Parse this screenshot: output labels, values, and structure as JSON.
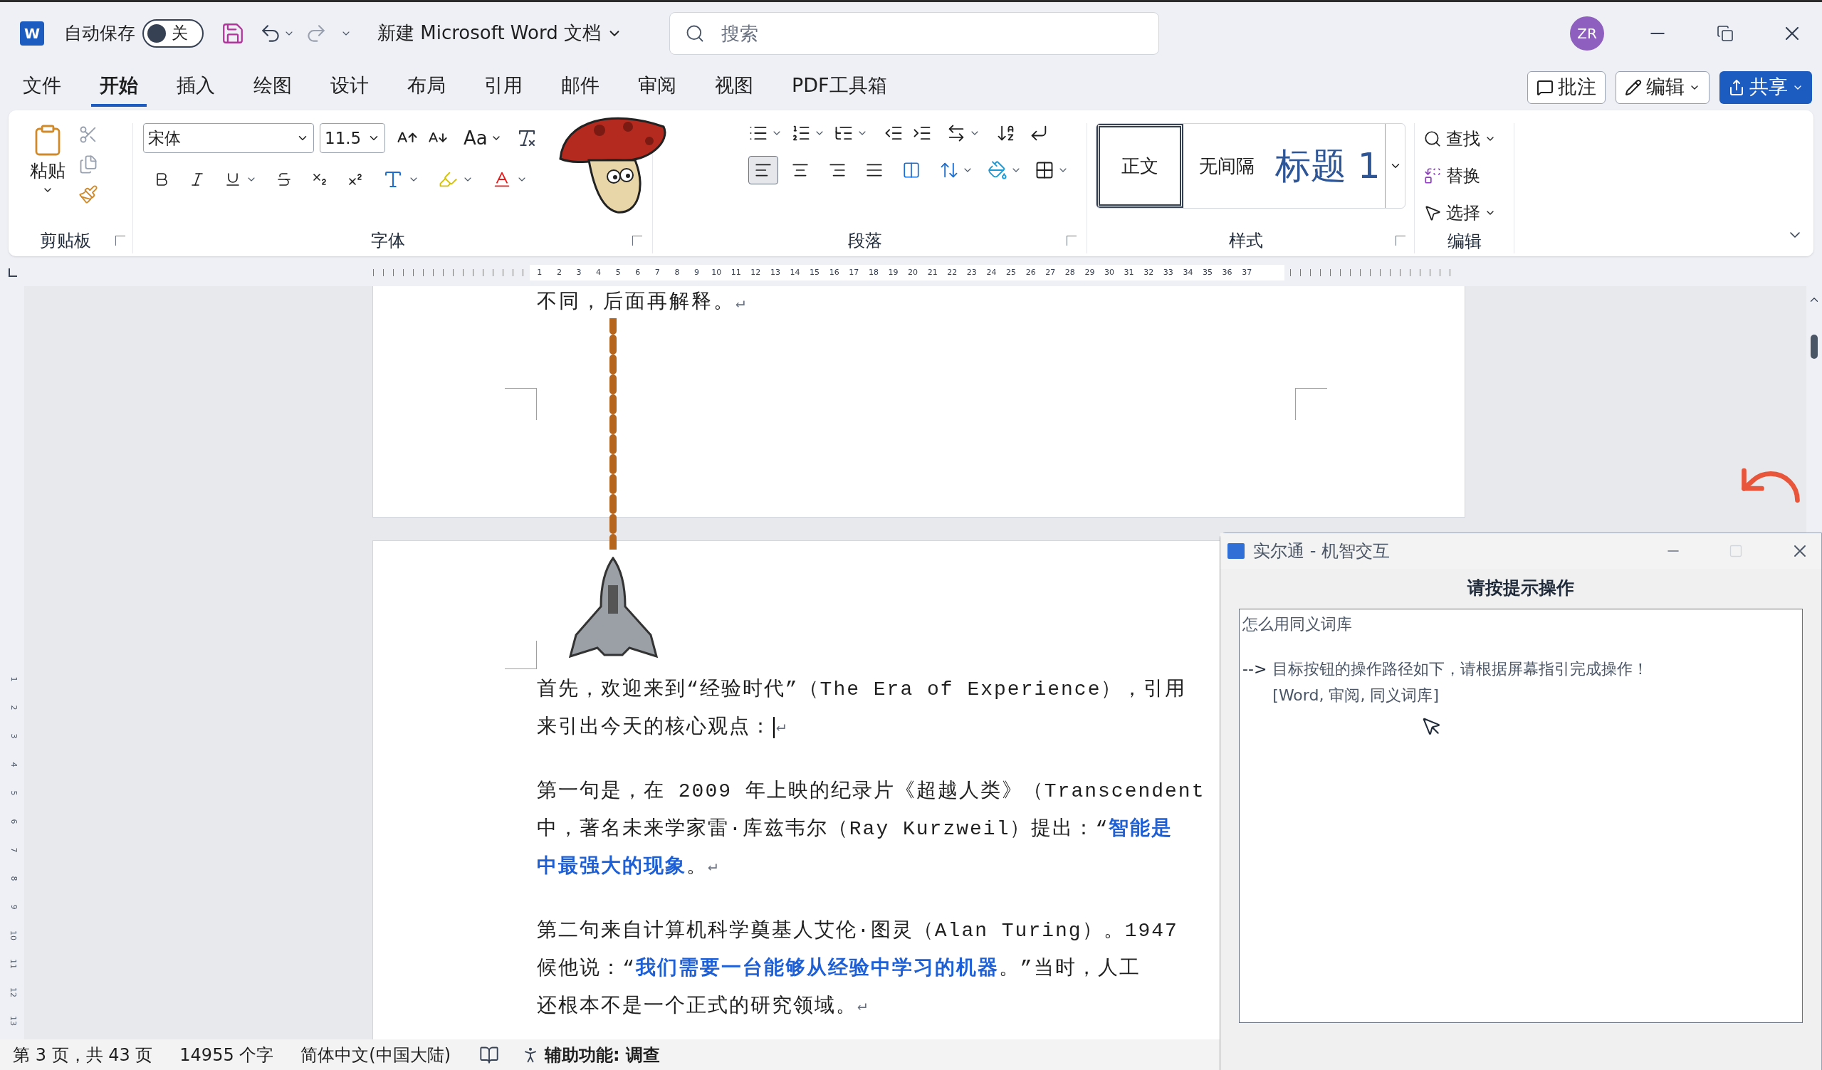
{
  "title_bar": {
    "app_badge": "W",
    "autosave": {
      "label": "自动保存",
      "on": false,
      "state_text": "关"
    },
    "document_title": "新建 Microsoft Word 文档",
    "search": {
      "placeholder": "搜索"
    },
    "avatar": "ZR"
  },
  "menu_tabs": [
    {
      "label": "文件",
      "selected": false
    },
    {
      "label": "开始",
      "selected": true
    },
    {
      "label": "插入",
      "selected": false
    },
    {
      "label": "绘图",
      "selected": false
    },
    {
      "label": "设计",
      "selected": false
    },
    {
      "label": "布局",
      "selected": false
    },
    {
      "label": "引用",
      "selected": false
    },
    {
      "label": "邮件",
      "selected": false
    },
    {
      "label": "审阅",
      "selected": false
    },
    {
      "label": "视图",
      "selected": false
    },
    {
      "label": "PDF工具箱",
      "selected": false
    }
  ],
  "header_buttons": [
    {
      "label": "批注",
      "kind": "comment"
    },
    {
      "label": "编辑",
      "kind": "edit"
    },
    {
      "label": "共享",
      "kind": "share"
    }
  ],
  "ribbon": {
    "clipboard": {
      "paste": "粘贴",
      "label": "剪贴板"
    },
    "font": {
      "name": "宋体",
      "size": "11.5",
      "case": "Aa",
      "label": "字体"
    },
    "paragraph": {
      "label": "段落",
      "alignments": [
        {
          "kind": "left",
          "selected": true
        },
        {
          "kind": "center",
          "selected": false
        },
        {
          "kind": "right",
          "selected": false
        },
        {
          "kind": "justify",
          "selected": false
        },
        {
          "kind": "distributed",
          "selected": false
        }
      ]
    },
    "styles": {
      "label": "样式",
      "items": [
        {
          "label": "正文",
          "selected": true,
          "kind": "normal"
        },
        {
          "label": "无间隔",
          "selected": false,
          "kind": "normal"
        },
        {
          "label": "标题 1",
          "selected": false,
          "kind": "heading"
        }
      ]
    },
    "editing": {
      "label": "编辑",
      "items": [
        {
          "label": "查找",
          "kind": "find"
        },
        {
          "label": "替换",
          "kind": "replace"
        },
        {
          "label": "选择",
          "kind": "select"
        }
      ]
    }
  },
  "ruler": {
    "numbers": [
      "1",
      "2",
      "3",
      "4",
      "5",
      "6",
      "7",
      "8",
      "9",
      "10",
      "11",
      "12",
      "13",
      "14",
      "15",
      "16",
      "17",
      "18",
      "19",
      "20",
      "21",
      "22",
      "23",
      "24",
      "25",
      "26",
      "27",
      "28",
      "29",
      "30",
      "31",
      "32",
      "33",
      "34",
      "35",
      "36",
      "37"
    ]
  },
  "vertical_ruler": {
    "numbers": [
      "1",
      "2",
      "3",
      "4",
      "5",
      "6",
      "7",
      "8",
      "9",
      "10",
      "11",
      "12",
      "13"
    ]
  },
  "page_1_lines": [
    {
      "text": "不同，后面再解释。",
      "mark": "↵"
    }
  ],
  "page_2_paragraphs": [
    {
      "lines": [
        {
          "text": "首先，欢迎来到“经验时代”（The Era of Experience），引用"
        },
        {
          "text": "来引出今天的核心观点：",
          "caret": true,
          "mark": "↵"
        }
      ]
    },
    {
      "lines": [
        {
          "text": "第一句是，在 2009 年上映的纪录片《超越人类》（Transcendent"
        },
        {
          "text": "中，著名未来学家雷·库兹韦尔（Ray Kurzweil）提出：“**智能是**"
        },
        {
          "text": "**中最强大的现象**。",
          "mark": "↵"
        }
      ]
    },
    {
      "lines": [
        {
          "text": "第二句来自计算机科学奠基人艾伦·图灵（Alan Turing）。1947"
        },
        {
          "text": "候他说：“**我们需要一台能够从经验中学习的机器**。”当时，人工"
        },
        {
          "text": "还根本不是一个正式的研究领域。",
          "mark": "↵"
        }
      ]
    }
  ],
  "status_bar": {
    "page_info": "第 3 页，共 43 页",
    "word_count": "14955 个字",
    "language": "简体中文(中国大陆)",
    "accessibility": "辅助功能: 调查"
  },
  "dialog": {
    "title": "实尔通 - 机智交互",
    "heading": "请按提示操作",
    "query": "怎么用同义词库",
    "arrow": "-->",
    "answer_lines": [
      "目标按钮的操作路径如下，请根据屏幕指引完成操作！",
      "[Word, 审阅, 同义词库]"
    ]
  }
}
